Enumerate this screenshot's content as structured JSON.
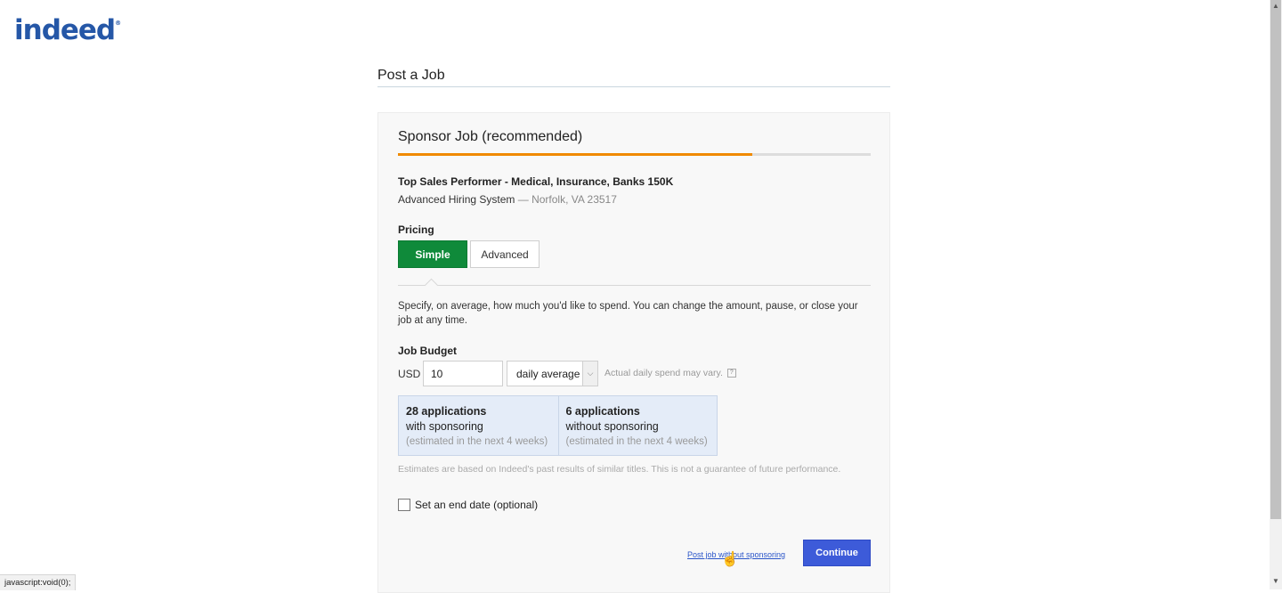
{
  "logo": {
    "text": "indeed",
    "mark": "®"
  },
  "page_title": "Post a Job",
  "card": {
    "title": "Sponsor Job (recommended)",
    "progress_percent": 75,
    "job_title": "Top Sales Performer - Medical, Insurance, Banks 150K",
    "company": "Advanced Hiring System",
    "location_sep": " — ",
    "location": "Norfolk, VA 23517"
  },
  "pricing": {
    "label": "Pricing",
    "simple_label": "Simple",
    "advanced_label": "Advanced",
    "description": "Specify, on average, how much you'd like to spend. You can change the amount, pause, or close your job at any time."
  },
  "budget": {
    "label": "Job Budget",
    "currency": "USD",
    "amount": "10",
    "frequency": "daily average",
    "note": "Actual daily spend may vary.",
    "help": "?"
  },
  "estimates": {
    "with": {
      "count": "28 applications",
      "label": "with sponsoring",
      "note": "(estimated in the next 4 weeks)"
    },
    "without": {
      "count": "6 applications",
      "label": "without sponsoring",
      "note": "(estimated in the next 4 weeks)"
    },
    "disclaimer": "Estimates are based on Indeed's past results of similar titles. This is not a guarantee of future performance."
  },
  "end_date": {
    "label": "Set an end date (optional)"
  },
  "actions": {
    "no_sponsor_link": "Post job without sponsoring",
    "continue_label": "Continue"
  },
  "status_bar": "javascript:void(0);",
  "colors": {
    "accent_green": "#0f8a3a",
    "accent_orange": "#f08a00",
    "button_blue": "#3d5bd9",
    "link_blue": "#2a55c9"
  }
}
